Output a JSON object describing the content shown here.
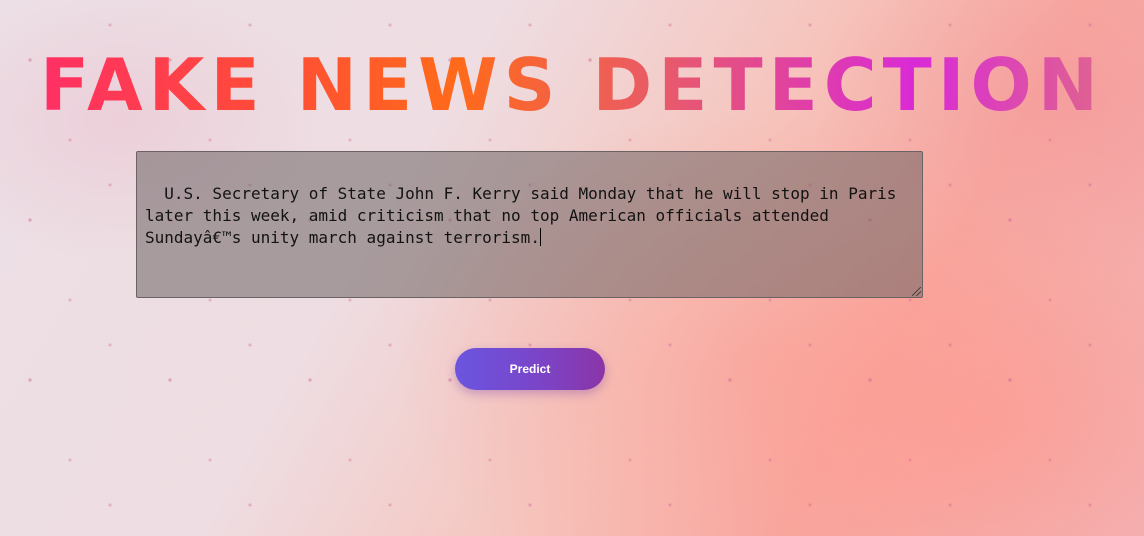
{
  "page": {
    "title": "FAKE NEWS DETECTION"
  },
  "news_input": {
    "value": "U.S. Secretary of State John F. Kerry said Monday that he will stop in Paris later this week, amid criticism that no top American officials attended Sundayâ€™s unity march against terrorism."
  },
  "actions": {
    "predict_label": "Predict"
  },
  "colors": {
    "title_gradient": [
      "#ff2a6d",
      "#ff6a1a",
      "#d92ad6"
    ],
    "button_gradient": [
      "#6a55e0",
      "#8b35a8"
    ]
  }
}
